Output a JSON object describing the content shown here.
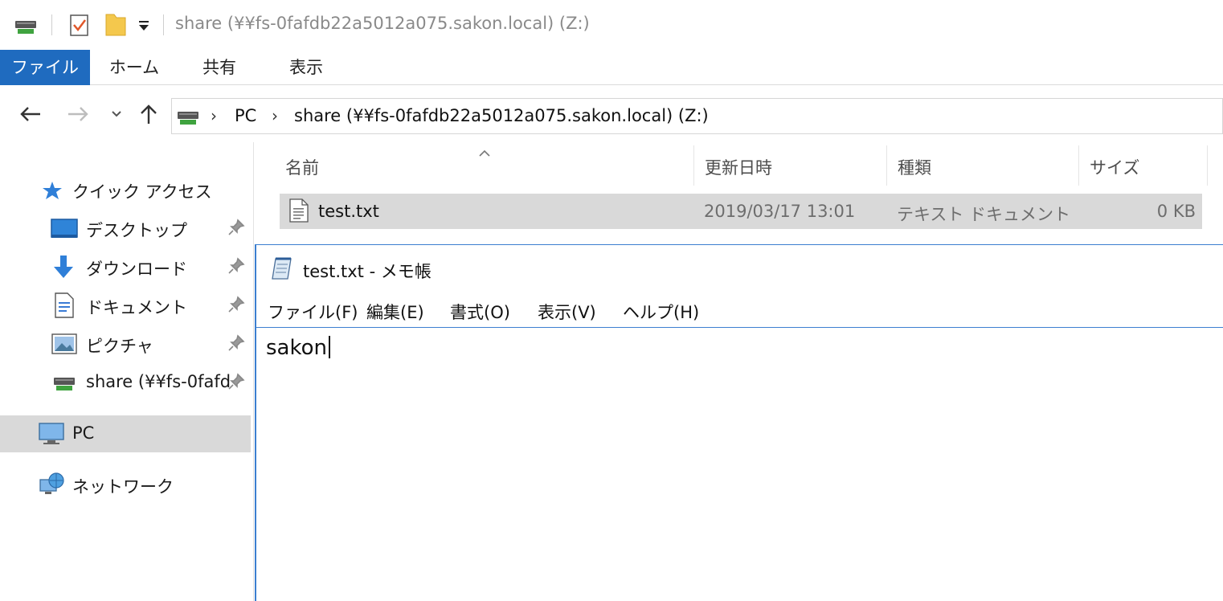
{
  "window": {
    "title": "share (¥¥fs-0fafdb22a5012a075.sakon.local) (Z:)"
  },
  "ribbon": {
    "tabs": [
      {
        "label": "ファイル",
        "active": true
      },
      {
        "label": "ホーム",
        "active": false
      },
      {
        "label": "共有",
        "active": false
      },
      {
        "label": "表示",
        "active": false
      }
    ]
  },
  "address": {
    "crumbs": [
      "PC",
      "share (¥¥fs-0fafdb22a5012a075.sakon.local) (Z:)"
    ]
  },
  "sidebar": {
    "items": [
      {
        "label": "クイック アクセス",
        "icon": "star-icon",
        "pinned": false
      },
      {
        "label": "デスクトップ",
        "icon": "desktop-icon",
        "pinned": true
      },
      {
        "label": "ダウンロード",
        "icon": "download-icon",
        "pinned": true
      },
      {
        "label": "ドキュメント",
        "icon": "documents-icon",
        "pinned": true
      },
      {
        "label": "ピクチャ",
        "icon": "pictures-icon",
        "pinned": true
      },
      {
        "label": "share (¥¥fs-0fafd",
        "icon": "network-drive-icon",
        "pinned": true
      },
      {
        "label": "PC",
        "icon": "pc-icon",
        "selected": true
      },
      {
        "label": "ネットワーク",
        "icon": "network-icon"
      }
    ]
  },
  "filelist": {
    "columns": [
      "名前",
      "更新日時",
      "種類",
      "サイズ"
    ],
    "files": [
      {
        "name": "test.txt",
        "modified": "2019/03/17 13:01",
        "type": "テキスト ドキュメント",
        "size": "0 KB"
      }
    ]
  },
  "notepad": {
    "title": "test.txt - メモ帳",
    "menu": [
      "ファイル(F)",
      "編集(E)",
      "書式(O)",
      "表示(V)",
      "ヘルプ(H)"
    ],
    "content": "sakon"
  },
  "colors": {
    "accent": "#1f6bbf",
    "selection": "#d9d9d9",
    "notepad_border": "#3c7fd0"
  }
}
